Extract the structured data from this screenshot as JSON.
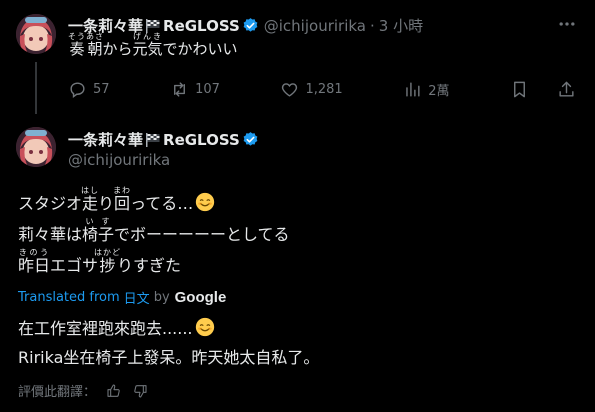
{
  "reply": {
    "display_name": "一条莉々華",
    "name_suffix": "ReGLOSS",
    "handle": "@ichijouririka",
    "separator": "·",
    "time": "3 小時",
    "text_parts": [
      {
        "base": "奏朝",
        "ruby": "そうあさ"
      },
      {
        "text": "から"
      },
      {
        "base": "元気",
        "ruby": "げんき"
      },
      {
        "text": "でかわいい"
      }
    ]
  },
  "actions": {
    "reply_count": "57",
    "repost_count": "107",
    "like_count": "1,281",
    "view_count": "2萬"
  },
  "main": {
    "display_name": "一条莉々華",
    "name_suffix": "ReGLOSS",
    "handle": "@ichijouririka",
    "lines": [
      [
        {
          "text": "スタジオ"
        },
        {
          "base": "走",
          "ruby": "はし"
        },
        {
          "text": "り"
        },
        {
          "base": "回",
          "ruby": "まわ"
        },
        {
          "text": "ってる…"
        }
      ],
      [
        {
          "text": "莉々華は"
        },
        {
          "base": "椅子",
          "ruby": "いす"
        },
        {
          "text": "でボーーーーーとしてる"
        }
      ],
      [
        {
          "base": "昨日",
          "ruby": "きのう"
        },
        {
          "text": "エゴサ"
        },
        {
          "base": "捗",
          "ruby": "はかど"
        },
        {
          "text": "りすぎた"
        }
      ]
    ],
    "translated_label": "Translated from",
    "translated_lang": "日文",
    "by": "by",
    "google": "Google",
    "translation_line1": "在工作室裡跑來跑去......",
    "translation_line2": "Ririka坐在椅子上發呆。昨天她太自私了。",
    "rate_label": "評價此翻譯："
  },
  "colors": {
    "accent": "#1d9bf0",
    "muted": "#71767b",
    "text": "#e7e9ea",
    "background": "#000000"
  }
}
